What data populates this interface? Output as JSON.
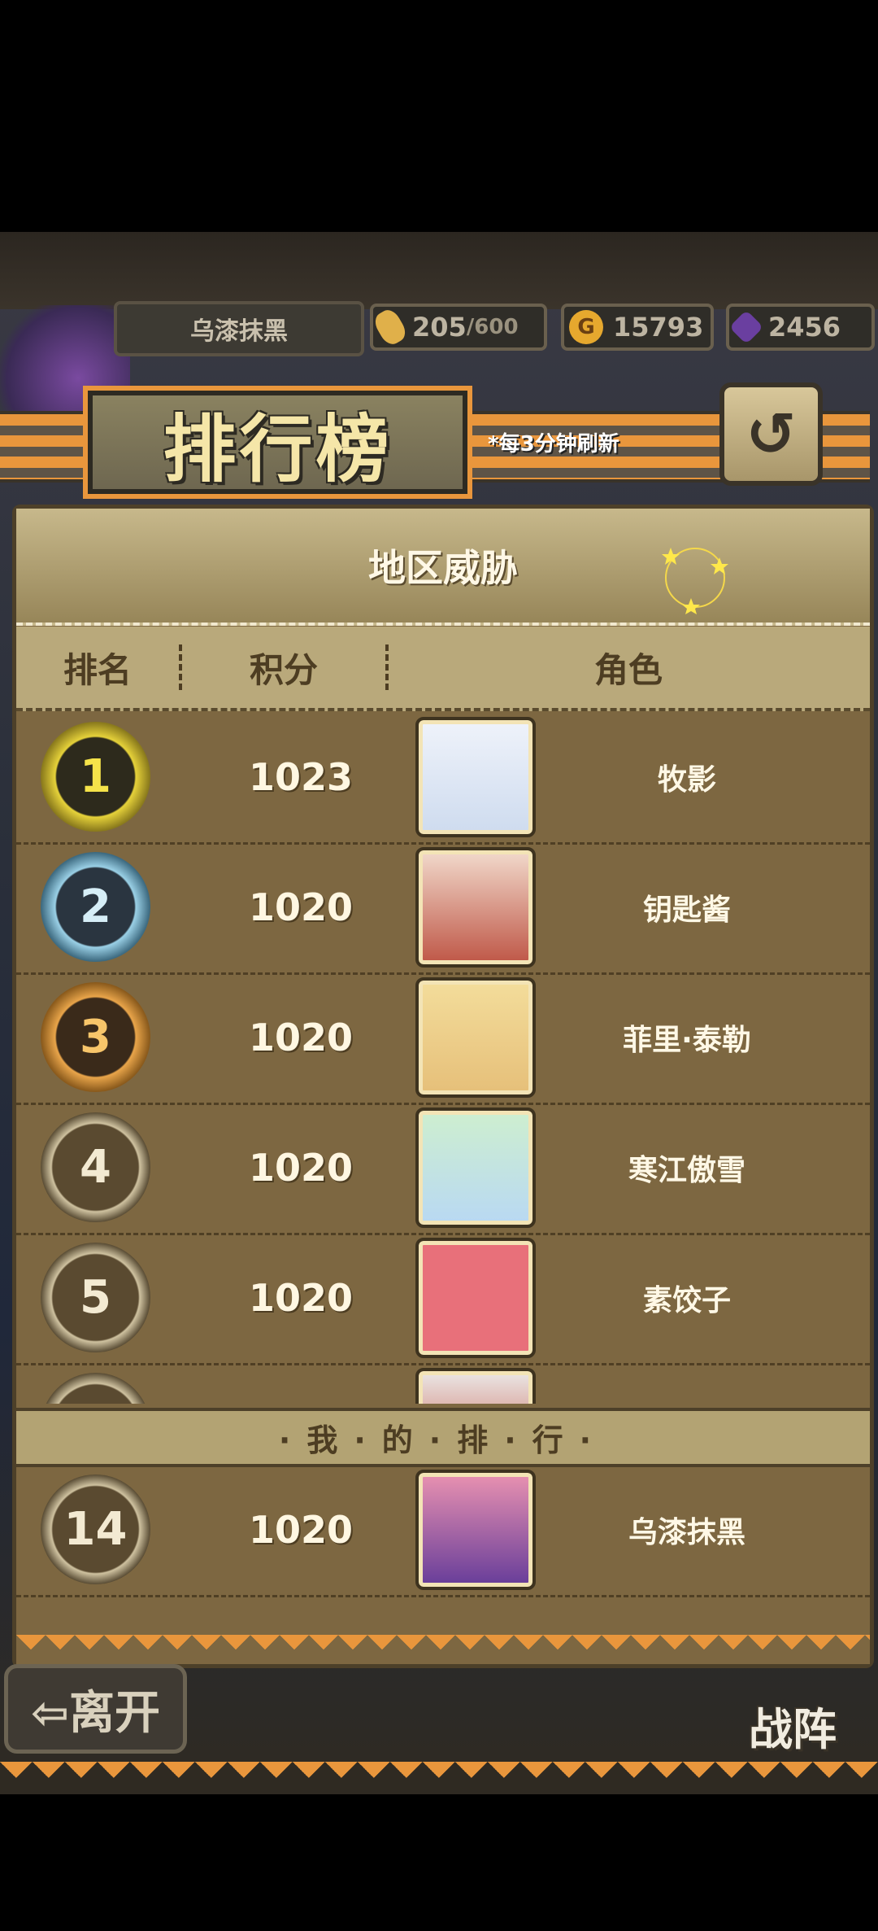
{
  "player": {
    "name": "乌漆抹黑"
  },
  "resources": {
    "stamina": {
      "value": "205",
      "max": "/600"
    },
    "gold": {
      "value": "15793",
      "icon_letter": "G"
    },
    "gems": {
      "value": "2456"
    }
  },
  "title": "排行榜",
  "refresh_note": "*每3分钟刷新",
  "back_glyph": "↺",
  "region_title": "地区威胁",
  "columns": {
    "rank": "排名",
    "score": "积分",
    "character": "角色"
  },
  "rows": [
    {
      "rank": "1",
      "score": "1023",
      "name": "牧影",
      "medal": "gold"
    },
    {
      "rank": "2",
      "score": "1020",
      "name": "钥匙酱",
      "medal": "silver"
    },
    {
      "rank": "3",
      "score": "1020",
      "name": "菲里·泰勒",
      "medal": "bronze"
    },
    {
      "rank": "4",
      "score": "1020",
      "name": "寒江傲雪",
      "medal": "plain"
    },
    {
      "rank": "5",
      "score": "1020",
      "name": "素饺子",
      "medal": "plain"
    },
    {
      "rank": "",
      "score": "",
      "name": "",
      "medal": "plain"
    }
  ],
  "my_rank_label": "·我·的·排·行·",
  "my_rank": {
    "rank": "14",
    "score": "1020",
    "name": "乌漆抹黑"
  },
  "buttons": {
    "leave": "⇦离开",
    "battle": "战阵"
  },
  "colors": {
    "accent_orange": "#e9963c",
    "panel_brown": "#7d6741",
    "gold_medal": "#e6d23a",
    "silver_medal": "#9ad0e6",
    "bronze_medal": "#e9a54a"
  }
}
